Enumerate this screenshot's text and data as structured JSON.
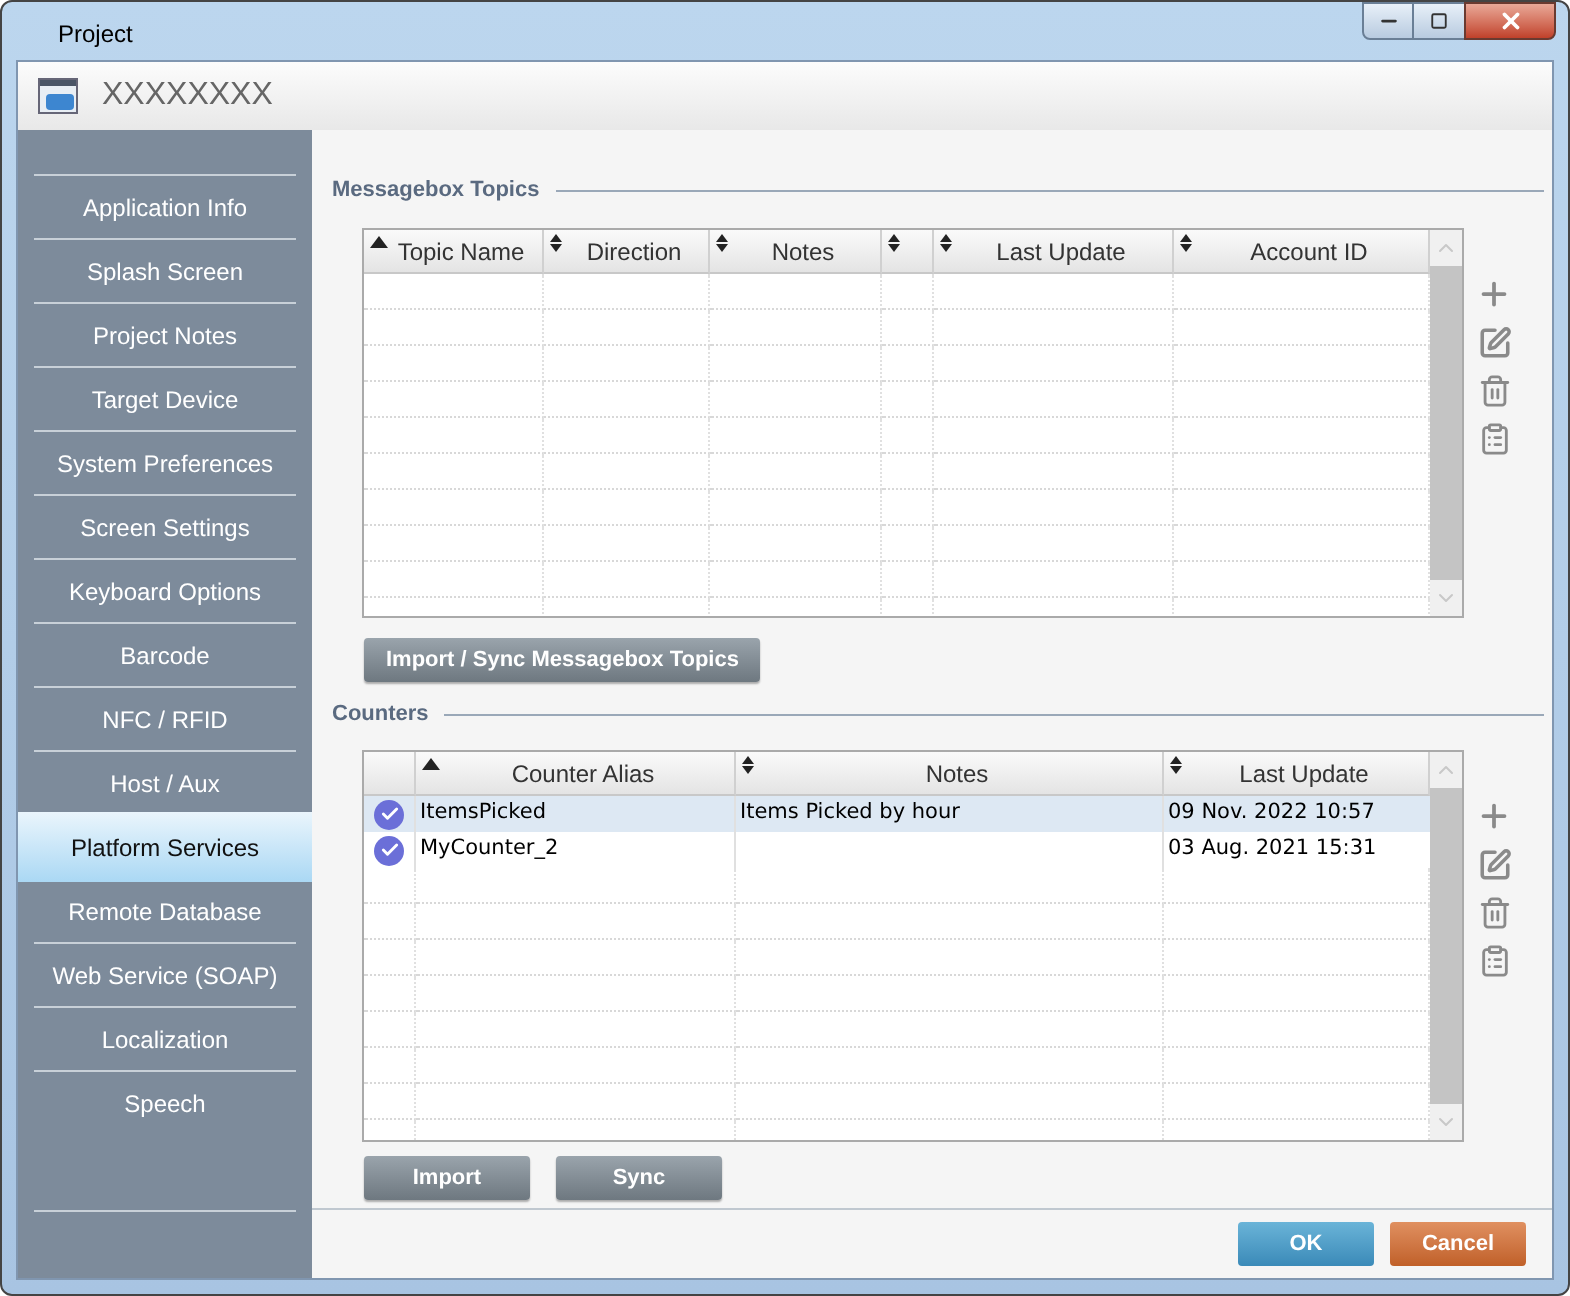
{
  "window": {
    "title": "Project"
  },
  "header": {
    "title": "XXXXXXXX"
  },
  "sidebar": {
    "items": [
      {
        "label": "Application Info",
        "selected": false
      },
      {
        "label": "Splash Screen",
        "selected": false
      },
      {
        "label": "Project Notes",
        "selected": false
      },
      {
        "label": "Target Device",
        "selected": false
      },
      {
        "label": "System Preferences",
        "selected": false
      },
      {
        "label": "Screen Settings",
        "selected": false
      },
      {
        "label": "Keyboard Options",
        "selected": false
      },
      {
        "label": "Barcode",
        "selected": false
      },
      {
        "label": "NFC / RFID",
        "selected": false
      },
      {
        "label": "Host / Aux",
        "selected": false
      },
      {
        "label": "Platform Services",
        "selected": true
      },
      {
        "label": "Remote Database",
        "selected": false
      },
      {
        "label": "Web Service (SOAP)",
        "selected": false
      },
      {
        "label": "Localization",
        "selected": false
      },
      {
        "label": "Speech",
        "selected": false
      }
    ]
  },
  "messagebox_topics": {
    "title": "Messagebox Topics",
    "columns": [
      {
        "label": "Topic Name",
        "sorted": true
      },
      {
        "label": "Direction",
        "sorted": false
      },
      {
        "label": "Notes",
        "sorted": false
      },
      {
        "sorted": false
      },
      {
        "label": "Last Update",
        "sorted": false
      },
      {
        "label": "Account ID",
        "sorted": false
      }
    ],
    "button": "Import / Sync Messagebox Topics"
  },
  "counters": {
    "title": "Counters",
    "columns": [
      {},
      {
        "label": "Counter Alias",
        "sorted": true
      },
      {
        "label": "Notes",
        "sorted": false
      },
      {
        "label": "Last Update",
        "sorted": false
      }
    ],
    "rows": [
      {
        "checked": true,
        "selected": true,
        "alias": "ItemsPicked",
        "notes": "Items Picked by hour",
        "last_update": "09 Nov. 2022 10:57"
      },
      {
        "checked": true,
        "selected": false,
        "alias": "MyCounter_2",
        "last_update": "03 Aug. 2021 15:31"
      }
    ],
    "buttons": [
      "Import",
      "Sync"
    ]
  },
  "footer": {
    "ok": "OK",
    "cancel": "Cancel"
  }
}
